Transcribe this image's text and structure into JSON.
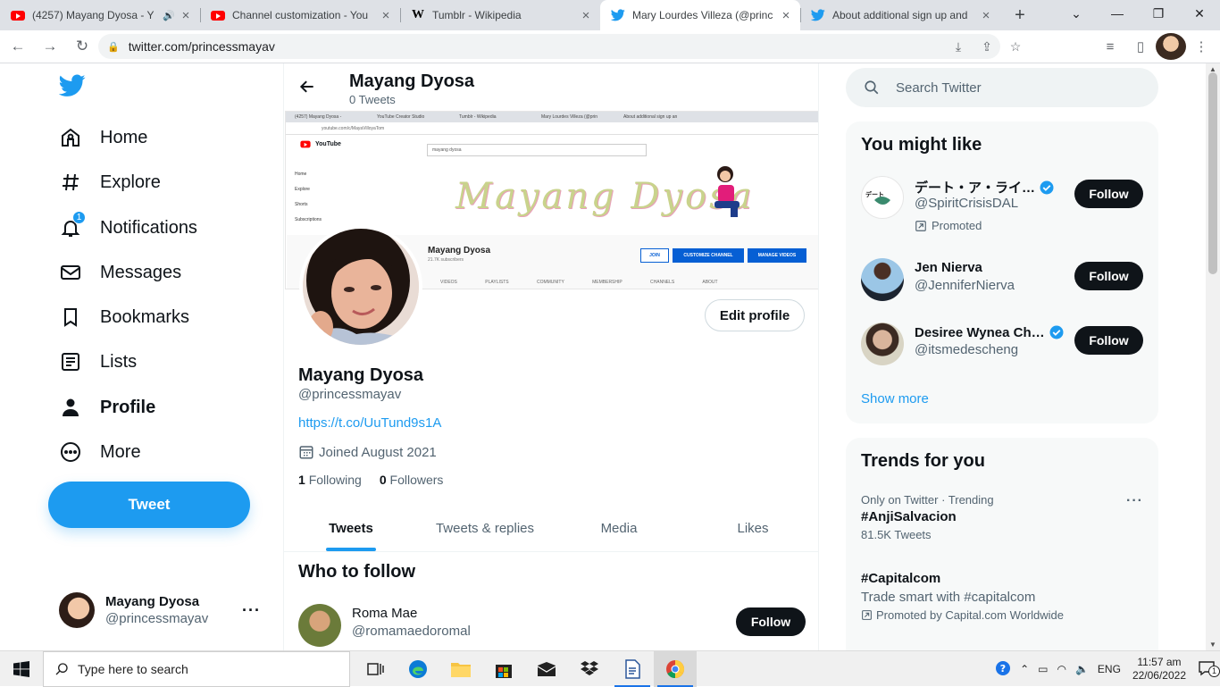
{
  "browser": {
    "tabs": [
      {
        "title": "(4257) Mayang Dyosa - Y",
        "icon": "youtube-icon",
        "audio": true,
        "active": false
      },
      {
        "title": "Channel customization - You",
        "icon": "youtube-icon",
        "active": false
      },
      {
        "title": "Tumblr - Wikipedia",
        "icon": "wikipedia-icon",
        "active": false
      },
      {
        "title": "Mary Lourdes Villeza (@princ",
        "icon": "twitter-icon",
        "active": true
      },
      {
        "title": "About additional sign up and",
        "icon": "twitter-icon",
        "active": false
      }
    ],
    "url": "twitter.com/princessmayav"
  },
  "twitter": {
    "nav": {
      "home": "Home",
      "explore": "Explore",
      "notifications": "Notifications",
      "notifications_badge": "1",
      "messages": "Messages",
      "bookmarks": "Bookmarks",
      "lists": "Lists",
      "profile": "Profile",
      "more": "More",
      "tweet": "Tweet"
    },
    "account": {
      "name": "Mayang Dyosa",
      "handle": "@princessmayav"
    },
    "header": {
      "name": "Mayang Dyosa",
      "tweet_count": "0 Tweets"
    },
    "banner": {
      "tabs": [
        "(4257) Mayang Dyosa -",
        "YouTube Creator Studio",
        "Tumblr - Wikipedia",
        "Mary Lourdes Villeza (@prin",
        "About additional sign up an"
      ],
      "url": "youtube.com/c/MayaVilloyaTom",
      "search": "mayang dyosa",
      "sidebar": [
        "Home",
        "Explore",
        "Shorts",
        "Subscriptions"
      ],
      "art_text": "Mayang Dyosa",
      "channel_name": "Mayang Dyosa",
      "subscribers": "21.7K subscribers",
      "join": "JOIN",
      "customize": "CUSTOMIZE CHANNEL",
      "manage": "MANAGE VIDEOS",
      "nav": "VIDEOS PLAYLISTS COMMUNITY MEMBERSHIP CHANNELS ABOUT"
    },
    "profile": {
      "edit": "Edit profile",
      "name": "Mayang Dyosa",
      "handle": "@princessmayav",
      "link": "https://t.co/UuTund9s1A",
      "joined": "Joined August 2021",
      "following_count": "1",
      "following_label": "Following",
      "followers_count": "0",
      "followers_label": "Followers"
    },
    "profile_tabs": [
      "Tweets",
      "Tweets & replies",
      "Media",
      "Likes"
    ],
    "who_to_follow": {
      "title": "Who to follow",
      "items": [
        {
          "name": "Roma Mae",
          "handle": "@romamaedoromal",
          "button": "Follow"
        }
      ]
    },
    "search_placeholder": "Search Twitter",
    "you_might_like": {
      "title": "You might like",
      "items": [
        {
          "name": "デート・ア・ライ…",
          "handle": "@SpiritCrisisDAL",
          "verified": true,
          "promoted": "Promoted",
          "button": "Follow"
        },
        {
          "name": "Jen Nierva",
          "handle": "@JenniferNierva",
          "verified": false,
          "button": "Follow"
        },
        {
          "name": "Desiree Wynea Ch…",
          "handle": "@itsmedescheng",
          "verified": true,
          "button": "Follow"
        }
      ],
      "show_more": "Show more"
    },
    "trends": {
      "title": "Trends for you",
      "items": [
        {
          "meta": "Only on Twitter · Trending",
          "topic": "#AnjiSalvacion",
          "count": "81.5K Tweets"
        },
        {
          "topic": "#Capitalcom",
          "desc": "Trade smart with #capitalcom",
          "promoted": "Promoted by Capital.com Worldwide"
        }
      ]
    }
  },
  "taskbar": {
    "search_placeholder": "Type here to search",
    "language": "ENG",
    "time": "11:57 am",
    "date": "22/06/2022",
    "notification_count": "1"
  },
  "colors": {
    "twitter_blue": "#1d9bf0",
    "text": "#0f1419",
    "secondary": "#536471"
  }
}
